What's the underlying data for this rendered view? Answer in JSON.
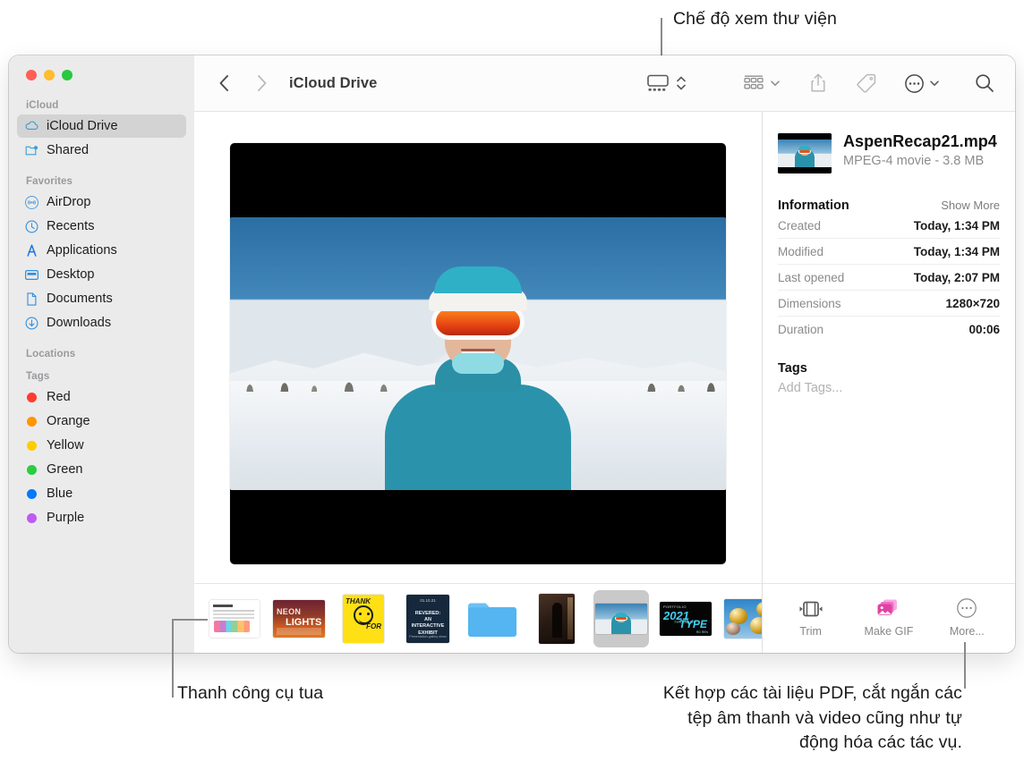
{
  "callouts": {
    "top": "Chế độ xem thư viện",
    "bottom_left": "Thanh công cụ tua",
    "bottom_right": "Kết hợp các tài liệu PDF, cắt ngắn các\ntệp âm thanh và video cũng như tự\nđộng hóa các tác vụ."
  },
  "window": {
    "traffic_lights": [
      "close-red",
      "minimize-yellow",
      "zoom-green"
    ]
  },
  "sidebar": {
    "sections": [
      {
        "title": "iCloud",
        "items": [
          {
            "label": "iCloud Drive",
            "icon": "cloud-icon",
            "selected": true
          },
          {
            "label": "Shared",
            "icon": "shared-folder-icon",
            "selected": false
          }
        ]
      },
      {
        "title": "Favorites",
        "items": [
          {
            "label": "AirDrop",
            "icon": "airdrop-icon",
            "selected": false
          },
          {
            "label": "Recents",
            "icon": "clock-icon",
            "selected": false
          },
          {
            "label": "Applications",
            "icon": "applications-icon",
            "selected": false
          },
          {
            "label": "Desktop",
            "icon": "desktop-icon",
            "selected": false
          },
          {
            "label": "Documents",
            "icon": "document-icon",
            "selected": false
          },
          {
            "label": "Downloads",
            "icon": "download-icon",
            "selected": false
          }
        ]
      },
      {
        "title": "Locations",
        "items": []
      },
      {
        "title": "Tags",
        "items": [
          {
            "label": "Red",
            "icon": "tag-dot",
            "color": "#ff3b30"
          },
          {
            "label": "Orange",
            "icon": "tag-dot",
            "color": "#ff9500"
          },
          {
            "label": "Yellow",
            "icon": "tag-dot",
            "color": "#ffcc00"
          },
          {
            "label": "Green",
            "icon": "tag-dot",
            "color": "#28cd41"
          },
          {
            "label": "Blue",
            "icon": "tag-dot",
            "color": "#007aff"
          },
          {
            "label": "Purple",
            "icon": "tag-dot",
            "color": "#bf5af2"
          }
        ]
      }
    ]
  },
  "toolbar": {
    "back_icon": "chevron-left-icon",
    "forward_icon": "chevron-right-icon",
    "breadcrumb": "iCloud Drive",
    "view_gallery_icon": "gallery-view-icon",
    "view_stepper_icon": "up-down-chevron-icon",
    "group_icon": "group-view-icon",
    "group_chevron_icon": "chevron-down-icon",
    "share_icon": "share-icon",
    "tag_icon": "tag-icon",
    "more_icon": "more-circle-icon",
    "more_chevron_icon": "chevron-down-icon",
    "search_icon": "search-icon"
  },
  "gallery": {
    "preview": {
      "name": "video-preview",
      "letterboxed": true,
      "scene": "skier-in-snow"
    },
    "thumbnails": [
      {
        "name": "chart-document",
        "kind": "doc"
      },
      {
        "name": "neon-lights-poster",
        "kind": "neon",
        "line1": "NEON",
        "line2": "LIGHTS"
      },
      {
        "name": "thank-you-poster",
        "kind": "yellow",
        "line1": "THANK",
        "line2": "FOR"
      },
      {
        "name": "revered-exhibit-poster",
        "kind": "navy",
        "date": "01.10.21",
        "heading": "REVERED:\nAN INTERACTIVE\nEXHIBIT",
        "footer": "Presentation gallery show"
      },
      {
        "name": "folder",
        "kind": "folder"
      },
      {
        "name": "silhouette-photo",
        "kind": "person"
      },
      {
        "name": "aspen-recap-video",
        "kind": "video",
        "selected": true
      },
      {
        "name": "typography-portfolio",
        "kind": "type",
        "p": "PORTFOLIO",
        "year": "2021",
        "sub": "TYPOGRAPHY",
        "big": "TYPE",
        "credit": "RG REN"
      },
      {
        "name": "gold-balloons-photo",
        "kind": "gold"
      }
    ]
  },
  "inspector": {
    "file": {
      "name": "AspenRecap21.mp4",
      "meta": "MPEG-4 movie - 3.8 MB",
      "thumb_name": "file-thumbnail"
    },
    "information": {
      "title": "Information",
      "show_more": "Show More",
      "rows": [
        {
          "key": "Created",
          "value": "Today, 1:34 PM"
        },
        {
          "key": "Modified",
          "value": "Today, 1:34 PM"
        },
        {
          "key": "Last opened",
          "value": "Today, 2:07 PM"
        },
        {
          "key": "Dimensions",
          "value": "1280×720"
        },
        {
          "key": "Duration",
          "value": "00:06"
        }
      ]
    },
    "tags": {
      "title": "Tags",
      "placeholder": "Add Tags..."
    },
    "quick_actions": [
      {
        "label": "Trim",
        "icon": "trim-icon"
      },
      {
        "label": "Make GIF",
        "icon": "make-gif-icon"
      },
      {
        "label": "More...",
        "icon": "more-circle-icon"
      }
    ]
  }
}
